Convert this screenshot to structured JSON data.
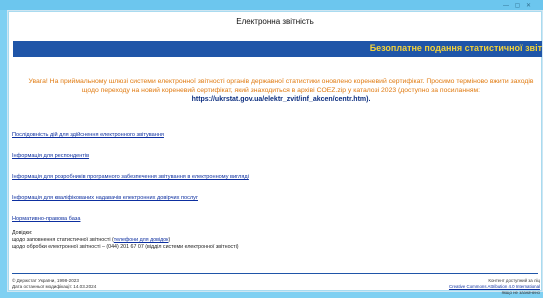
{
  "page": {
    "title": "Електронна звітність",
    "banner": "Безоплатне подання статистичної звіт"
  },
  "notice": {
    "text": "Увага! На приймальному шлюзі системи електронної звітності органів державної статистики оновлено кореневий сертифікат. Просимо терміново вжити заходів щодо переходу на новий кореневий сертифікат, який знаходиться в архіві COEZ.zip у каталозі 2023 (доступно за посиланням:",
    "url": "https://ukrstat.gov.ua/elektr_zvit/inf_akcen/centr.htm)."
  },
  "links": [
    "Послідовність дій для здійснення електронного звітування",
    "Інформація для респондентів",
    "Інформація для розробників програмного забезпечення звітування в електронному вигляді",
    "Інформація для кваліфікованих надавачів електронних довірчих послуг",
    "Нормативно-правова база"
  ],
  "help": {
    "heading": "Довідки:",
    "line1_text": "щодо заповнення статистичної звітності (",
    "line1_link": "телефони для довідок",
    "line1_end": ")",
    "line2": "щодо обробки електронної звітності – (044) 201 67 07 (відділ системи електронної звітності)"
  },
  "footer": {
    "left1": "© Держстат України, 1998-2023",
    "left2": "Дата останньої модифікації: 14.03.2024",
    "right1": "Контент доступний за ліц",
    "right2": "Creative Commons Attribution 4.0 International",
    "right3": "якщо не зазначено"
  },
  "colors": {
    "background": "#7fd0f2",
    "banner": "#1f55a8",
    "banner_text": "#f3d23a",
    "notice": "#e07a10",
    "link": "#0d2fa0"
  }
}
